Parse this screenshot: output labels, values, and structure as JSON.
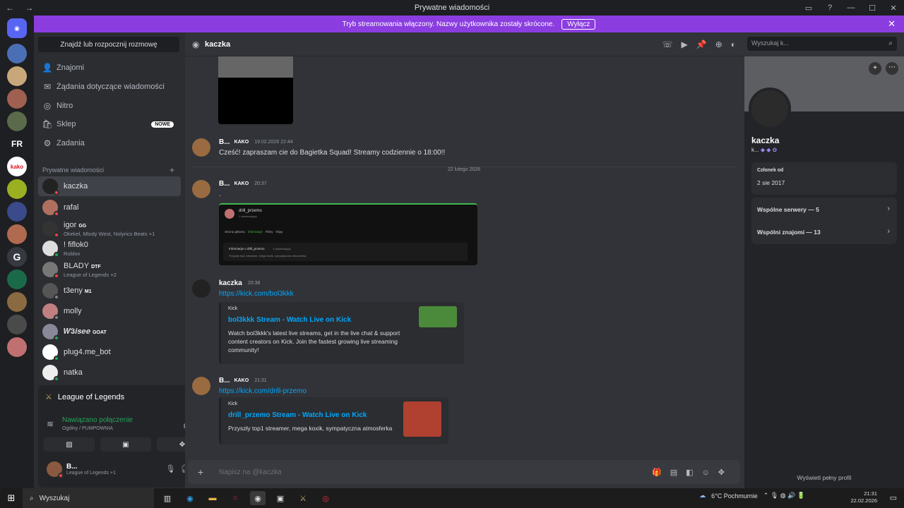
{
  "window": {
    "title": "Prywatne wiadomości"
  },
  "banner": {
    "text": "Tryb streamowania włączony. Nazwy użytkownika zostały skrócone.",
    "button": "Wyłącz"
  },
  "dm_panel": {
    "find_label": "Znajdź lub rozpocznij rozmowę",
    "nav": [
      "Znajomi",
      "Żądania dotyczące wiadomości",
      "Nitro",
      "Sklep",
      "Zadania"
    ],
    "shop_badge": "NOWE",
    "section_label": "Prywatne wiadomości",
    "dms": [
      {
        "name": "kaczka",
        "sub": ""
      },
      {
        "name": "rafal",
        "sub": ""
      },
      {
        "name": "igor",
        "tag": "GG",
        "sub": "Okekel, Mlody West, Nolyrics Beats +1"
      },
      {
        "name": "! fiflok0",
        "sub": "Roblox"
      },
      {
        "name": "BLADY",
        "tag": "DTF",
        "sub": "League of Legends +2"
      },
      {
        "name": "t3eny",
        "tag": "M1",
        "sub": ""
      },
      {
        "name": "molly",
        "sub": ""
      },
      {
        "name": "𝑾𝟑𝒊𝒔𝒆𝒆",
        "tag": "GOAT",
        "sub": ""
      },
      {
        "name": "plug4.me_bot",
        "sub": ""
      },
      {
        "name": "natka",
        "sub": ""
      }
    ]
  },
  "voice_panel": {
    "game": "League of Legends",
    "status": "Nawiązano połączenie",
    "channel": "Ogólny / PUMPOWNIA",
    "user_name": "B...",
    "user_status": "League of Legends +1"
  },
  "chat": {
    "recipient": "kaczka",
    "search_placeholder": "Wyszukaj k...",
    "date_divider": "22 lutego 2026",
    "messages": [
      {
        "author": "B...",
        "badge": "KAKO",
        "time": "19.02.2026 22:44",
        "text": "Cześć! zapraszam cie do Bagietka Squad! Streamy codziennie o 18:00!!"
      },
      {
        "author": "B...",
        "badge": "KAKO",
        "time": "20:37",
        "text": "."
      },
      {
        "author": "kaczka",
        "badge": "",
        "time": "20:38",
        "text": "https://kick.com/bol3kkk",
        "embed": {
          "provider": "Kick",
          "title": "bol3kkk Stream - Watch Live on Kick",
          "desc": "Watch bol3kkk's latest live streams, get in the live chat & support content creators on Kick. Join the fastest growing live streaming community!"
        }
      },
      {
        "author": "B...",
        "badge": "KAKO",
        "time": "21:31",
        "text": "https://kick.com/drill-przemo",
        "embed": {
          "provider": "Kick",
          "title": "drill_przemo Stream - Watch Live on Kick",
          "desc": "Przyszły top1 streamer, mega koxik, sympatyczna atmosferka"
        }
      }
    ],
    "shot": {
      "channel": "drill_przemo",
      "followers": "1 obserwujący",
      "tabs": [
        "Strona główna",
        "Informacje",
        "Filmy",
        "Klipy"
      ],
      "info_title": "Informacje o drill_przemo",
      "info_followers": "1 obserwujący",
      "info_text": "Przyszły top1 streamer, mega koxik, sympatyczna atmosferka"
    },
    "composer_placeholder": "Napisz na @kaczka"
  },
  "profile": {
    "name": "kaczka",
    "sub": "k...",
    "member_since_label": "Członek od",
    "member_since": "2 sie 2017",
    "mutual_servers": "Wspólne serwery — 5",
    "mutual_friends": "Wspólni znajomi — 13",
    "full_profile": "Wyświetl pełny profil"
  },
  "taskbar": {
    "search": "Wyszukaj",
    "weather": "6°C Pochmurnie",
    "time": "21:31",
    "date": "22.02.2026"
  }
}
